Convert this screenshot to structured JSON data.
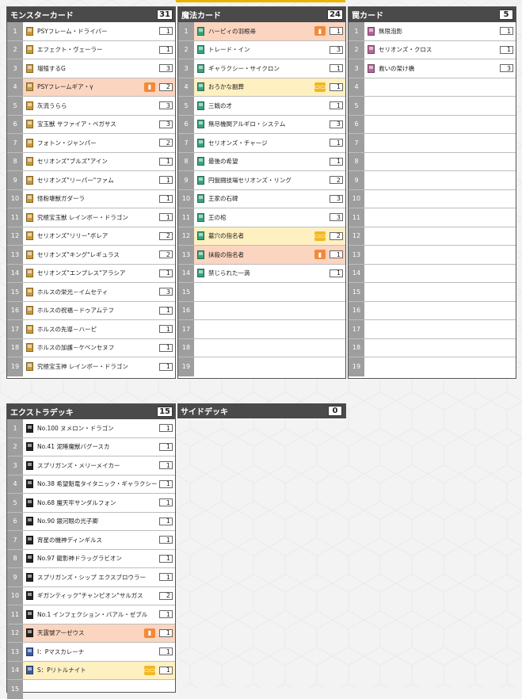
{
  "monster": {
    "title": "モンスターカード",
    "count": "31",
    "rows": [
      {
        "n": "1",
        "name": "PSYフレーム・ドライバー",
        "qty": "1",
        "type": "monster",
        "hl": ""
      },
      {
        "n": "2",
        "name": "エフェクト・ヴェーラー",
        "qty": "1",
        "type": "monster",
        "hl": ""
      },
      {
        "n": "3",
        "name": "増殖するG",
        "qty": "3",
        "type": "monster",
        "hl": ""
      },
      {
        "n": "4",
        "name": "PSYフレームギア・γ",
        "qty": "2",
        "type": "monster",
        "hl": "red",
        "badge": "lim1"
      },
      {
        "n": "5",
        "name": "灰流うらら",
        "qty": "3",
        "type": "monster",
        "hl": ""
      },
      {
        "n": "6",
        "name": "宝玉獣 サファイア・ペガサス",
        "qty": "3",
        "type": "monster",
        "hl": ""
      },
      {
        "n": "7",
        "name": "フォトン・ジャンパー",
        "qty": "2",
        "type": "monster",
        "hl": ""
      },
      {
        "n": "8",
        "name": "セリオンズ\"ブルズ\"アイン",
        "qty": "1",
        "type": "monster",
        "hl": ""
      },
      {
        "n": "9",
        "name": "セリオンズ\"リーパー\"ファム",
        "qty": "1",
        "type": "monster",
        "hl": ""
      },
      {
        "n": "10",
        "name": "怪粉壊獣ガダーラ",
        "qty": "1",
        "type": "monster",
        "hl": ""
      },
      {
        "n": "11",
        "name": "究極宝玉獣 レインボー・ドラゴン",
        "qty": "1",
        "type": "monster",
        "hl": ""
      },
      {
        "n": "12",
        "name": "セリオンズ\"リリー\"ボレア",
        "qty": "2",
        "type": "monster",
        "hl": ""
      },
      {
        "n": "13",
        "name": "セリオンズ\"キング\"レギュラス",
        "qty": "2",
        "type": "monster",
        "hl": ""
      },
      {
        "n": "14",
        "name": "セリオンズ\"エンプレス\"アラシア",
        "qty": "1",
        "type": "monster",
        "hl": ""
      },
      {
        "n": "15",
        "name": "ホルスの栄光－イムセティ",
        "qty": "3",
        "type": "monster",
        "hl": ""
      },
      {
        "n": "16",
        "name": "ホルスの祝福－ドゥアムテフ",
        "qty": "1",
        "type": "monster",
        "hl": ""
      },
      {
        "n": "17",
        "name": "ホルスの先導－ハーピ",
        "qty": "1",
        "type": "monster",
        "hl": ""
      },
      {
        "n": "18",
        "name": "ホルスの加護－ケベンセヌフ",
        "qty": "1",
        "type": "monster",
        "hl": ""
      },
      {
        "n": "19",
        "name": "究極宝玉神 レインボー・ドラゴン",
        "qty": "1",
        "type": "monster",
        "hl": ""
      }
    ]
  },
  "spell": {
    "title": "魔法カード",
    "count": "24",
    "rows": [
      {
        "n": "1",
        "name": "ハーピィの羽根帚",
        "qty": "1",
        "type": "spell",
        "hl": "red",
        "badge": "lim1"
      },
      {
        "n": "2",
        "name": "トレード・イン",
        "qty": "3",
        "type": "spell",
        "hl": ""
      },
      {
        "n": "3",
        "name": "ギャラクシー・サイクロン",
        "qty": "1",
        "type": "spell",
        "hl": ""
      },
      {
        "n": "4",
        "name": "おろかな副葬",
        "qty": "1",
        "type": "spell",
        "hl": "yel",
        "badge": "lim2"
      },
      {
        "n": "5",
        "name": "三戦の才",
        "qty": "1",
        "type": "spell",
        "hl": ""
      },
      {
        "n": "6",
        "name": "無尽機関アルギロ・システム",
        "qty": "3",
        "type": "spell",
        "hl": ""
      },
      {
        "n": "7",
        "name": "セリオンズ・チャージ",
        "qty": "1",
        "type": "spell",
        "hl": ""
      },
      {
        "n": "8",
        "name": "最後の希望",
        "qty": "1",
        "type": "spell",
        "hl": ""
      },
      {
        "n": "9",
        "name": "円盤闘技場セリオンズ・リング",
        "qty": "2",
        "type": "spell",
        "hl": ""
      },
      {
        "n": "10",
        "name": "王家の石碑",
        "qty": "3",
        "type": "spell",
        "hl": ""
      },
      {
        "n": "11",
        "name": "王の棺",
        "qty": "3",
        "type": "spell",
        "hl": ""
      },
      {
        "n": "12",
        "name": "墓穴の指名者",
        "qty": "2",
        "type": "spell",
        "hl": "yel",
        "badge": "lim2"
      },
      {
        "n": "13",
        "name": "抹殺の指名者",
        "qty": "1",
        "type": "spell",
        "hl": "red",
        "badge": "lim1"
      },
      {
        "n": "14",
        "name": "禁じられた一滴",
        "qty": "1",
        "type": "spell",
        "hl": ""
      },
      {
        "n": "15"
      },
      {
        "n": "16"
      },
      {
        "n": "17"
      },
      {
        "n": "18"
      },
      {
        "n": "19"
      }
    ]
  },
  "trap": {
    "title": "罠カード",
    "count": "5",
    "rows": [
      {
        "n": "1",
        "name": "無限泡影",
        "qty": "1",
        "type": "trap",
        "hl": ""
      },
      {
        "n": "2",
        "name": "セリオンズ・クロス",
        "qty": "1",
        "type": "trap",
        "hl": ""
      },
      {
        "n": "3",
        "name": "救いの架け橋",
        "qty": "3",
        "type": "trap",
        "hl": ""
      },
      {
        "n": "4"
      },
      {
        "n": "5"
      },
      {
        "n": "6"
      },
      {
        "n": "7"
      },
      {
        "n": "8"
      },
      {
        "n": "9"
      },
      {
        "n": "10"
      },
      {
        "n": "11"
      },
      {
        "n": "12"
      },
      {
        "n": "13"
      },
      {
        "n": "14"
      },
      {
        "n": "15"
      },
      {
        "n": "16"
      },
      {
        "n": "17"
      },
      {
        "n": "18"
      },
      {
        "n": "19"
      }
    ]
  },
  "extra": {
    "title": "エクストラデッキ",
    "count": "15",
    "rows": [
      {
        "n": "1",
        "name": "No.100 ヌメロン・ドラゴン",
        "qty": "1",
        "type": "xyz",
        "hl": ""
      },
      {
        "n": "2",
        "name": "No.41 泥睡魔獣バグースカ",
        "qty": "1",
        "type": "xyz",
        "hl": ""
      },
      {
        "n": "3",
        "name": "スプリガンズ・メリーメイカー",
        "qty": "1",
        "type": "xyz",
        "hl": ""
      },
      {
        "n": "4",
        "name": "No.38 希望魁竜タイタニック・ギャラクシー",
        "qty": "1",
        "type": "xyz",
        "hl": ""
      },
      {
        "n": "5",
        "name": "No.68 魔天牢サンダルフォン",
        "qty": "1",
        "type": "xyz",
        "hl": ""
      },
      {
        "n": "6",
        "name": "No.90 銀河眼の光子卿",
        "qty": "1",
        "type": "xyz",
        "hl": ""
      },
      {
        "n": "7",
        "name": "宵星の機神ディンギルス",
        "qty": "1",
        "type": "xyz",
        "hl": ""
      },
      {
        "n": "8",
        "name": "No.97 龍影神ドラッグラビオン",
        "qty": "1",
        "type": "xyz",
        "hl": ""
      },
      {
        "n": "9",
        "name": "スプリガンズ・シップ エクスブロウラー",
        "qty": "1",
        "type": "xyz",
        "hl": ""
      },
      {
        "n": "10",
        "name": "ギガンティック\"チャンピオン\"サルガス",
        "qty": "2",
        "type": "xyz",
        "hl": ""
      },
      {
        "n": "11",
        "name": "No.1 インフェクション・バアル・ゼブル",
        "qty": "1",
        "type": "xyz",
        "hl": ""
      },
      {
        "n": "12",
        "name": "天霆號アーゼウス",
        "qty": "1",
        "type": "xyz",
        "hl": "red",
        "badge": "lim1"
      },
      {
        "n": "13",
        "name": "I：Pマスカレーナ",
        "qty": "1",
        "type": "link",
        "hl": ""
      },
      {
        "n": "14",
        "name": "S：Pリトルナイト",
        "qty": "1",
        "type": "link",
        "hl": "yel",
        "badge": "lim2"
      },
      {
        "n": "15",
        "name": "",
        "qty": "",
        "type": "",
        "hl": ""
      }
    ]
  },
  "side": {
    "title": "サイドデッキ",
    "count": "0"
  },
  "icons": {
    "lim1": "limit-1-icon",
    "lim2": "limit-2-icon"
  },
  "colors": {
    "limited_highlight": "#fbd5c0",
    "semi_limited_highlight": "#fff0c2",
    "header": "#4a4a4a"
  }
}
